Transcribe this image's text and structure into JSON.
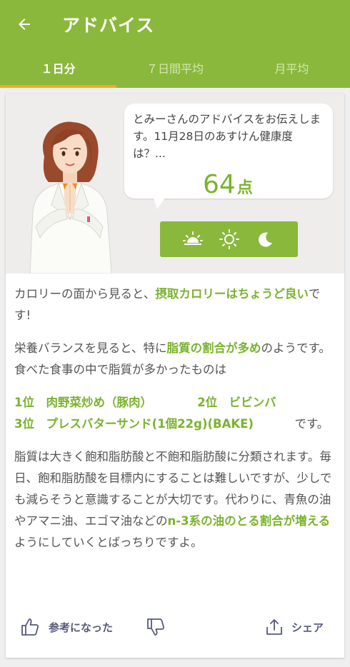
{
  "appbar": {
    "title": "アドバイス",
    "back_icon": "arrow-left-icon"
  },
  "tabs": [
    {
      "label": "１日分",
      "active": true
    },
    {
      "label": "７日間平均",
      "active": false
    },
    {
      "label": "月平均",
      "active": false
    }
  ],
  "advice": {
    "bubble_text": "とみーさんのアドバイスをお伝えします。11月28日のあすけん健康度は？...",
    "score": "64",
    "score_unit": "点",
    "times": [
      "sunrise-icon",
      "sun-icon",
      "moon-icon"
    ]
  },
  "body": {
    "p1_a": "カロリーの面から見ると、",
    "p1_hl": "摂取カロリーはちょうど良い",
    "p1_b": "です!",
    "p2_a": "栄養バランスを見ると、特に",
    "p2_hl": "脂質の割合が多め",
    "p2_b": "のようです。食べた食事の中で脂質が多かったものは",
    "p3_r1": "1位　肉野菜炒め（豚肉）",
    "p3_r2": "2位　ビビンバ",
    "p3_r3": "3位　プレスバターサンド(1個22g)(BAKE)",
    "p3_end": "です。",
    "p4_a": "脂質は大きく飽和脂肪酸と不飽和脂肪酸に分類されます。毎日、飽和脂肪酸を目標内にすることは難しいですが、少しでも減らそうと意識することが大切です。代わりに、青魚の油やアマニ油、エゴマ油などの",
    "p4_hl": "n-3系の油のとる割合が増える",
    "p4_b": "ようにしていくとばっちりですよ。"
  },
  "actions": {
    "helpful_label": "参考になった",
    "share_label": "シェア"
  },
  "colors": {
    "primary": "#8ab83c",
    "accent": "#f6a91e",
    "highlight": "#7ab32e"
  }
}
